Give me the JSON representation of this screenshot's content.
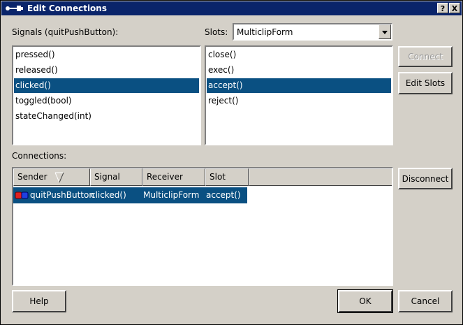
{
  "window": {
    "title": "Edit Connections",
    "help_glyph": "?",
    "close_glyph": "X"
  },
  "signals": {
    "label": "Signals (quitPushButton):",
    "items": [
      "pressed()",
      "released()",
      "clicked()",
      "toggled(bool)",
      "stateChanged(int)"
    ],
    "selected": "clicked()"
  },
  "slots": {
    "label": "Slots:",
    "combo_value": "MulticlipForm",
    "items": [
      "close()",
      "exec()",
      "accept()",
      "reject()"
    ],
    "selected": "accept()"
  },
  "buttons": {
    "connect": "Connect",
    "edit_slots": "Edit Slots",
    "disconnect": "Disconnect",
    "help": "Help",
    "ok": "OK",
    "cancel": "Cancel"
  },
  "connections": {
    "label": "Connections:",
    "columns": [
      "Sender",
      "Signal",
      "Receiver",
      "Slot"
    ],
    "rows": [
      {
        "sender": "quitPushButton",
        "signal": "clicked()",
        "receiver": "MulticlipForm",
        "slot": "accept()"
      }
    ]
  },
  "colors": {
    "title_bar": "#0a246a",
    "selection": "#0a5082",
    "face": "#d4d0c8"
  }
}
